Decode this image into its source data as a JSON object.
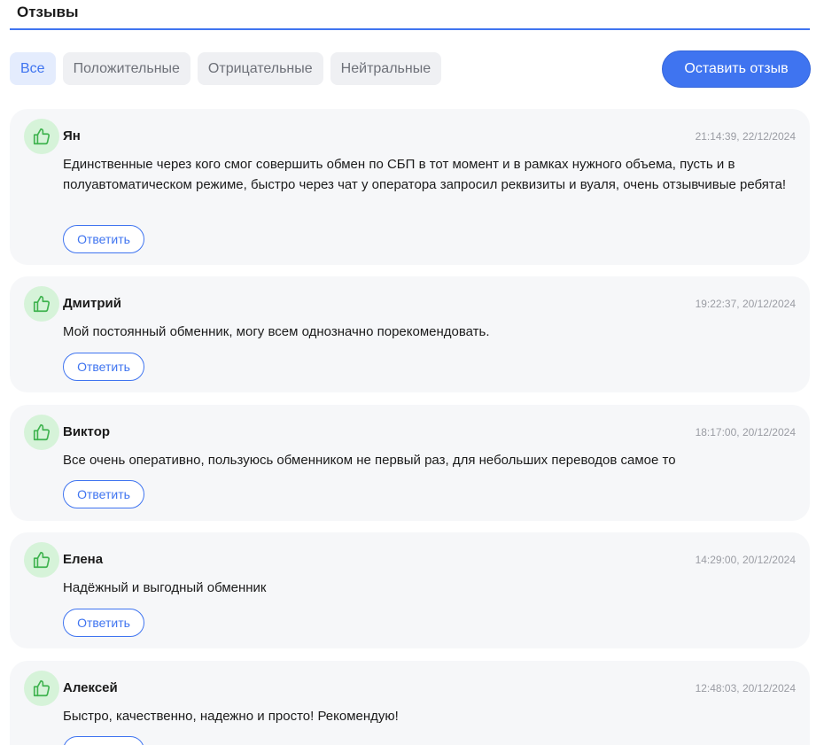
{
  "section": {
    "title": "Отзывы"
  },
  "filters": [
    {
      "label": "Все",
      "active": true
    },
    {
      "label": "Положительные",
      "active": false
    },
    {
      "label": "Отрицательные",
      "active": false
    },
    {
      "label": "Нейтральные",
      "active": false
    }
  ],
  "leave_review_label": "Оставить отзыв",
  "colors": {
    "accent": "#3f74f0",
    "card_bg": "#f6f7f9",
    "positive_icon_bg": "#d6f3d9",
    "positive_icon": "#3fb34f"
  },
  "reviews": [
    {
      "author": "Ян",
      "date": "21:14:39, 22/12/2024",
      "text": "Единственные через кого смог совершить обмен по СБП в тот момент и в рамках нужного объема, пусть и в полуавтоматическом режиме, быстро через чат у оператора запросил реквизиты и вуаля, очень отзывчивые ребята!",
      "sentiment_icon": "thumbs-up-icon",
      "reply_label": "Ответить"
    },
    {
      "author": "Дмитрий",
      "date": "19:22:37, 20/12/2024",
      "text": "Мой постоянный обменник, могу всем однозначно порекомендовать.",
      "sentiment_icon": "thumbs-up-icon",
      "reply_label": "Ответить"
    },
    {
      "author": "Виктор",
      "date": "18:17:00, 20/12/2024",
      "text": "Все очень оперативно, пользуюсь обменником не первый раз, для небольших переводов самое то",
      "sentiment_icon": "thumbs-up-icon",
      "reply_label": "Ответить"
    },
    {
      "author": "Елена",
      "date": "14:29:00, 20/12/2024",
      "text": "Надёжный и выгодный обменник",
      "sentiment_icon": "thumbs-up-icon",
      "reply_label": "Ответить"
    },
    {
      "author": "Алексей",
      "date": "12:48:03, 20/12/2024",
      "text": "Быстро, качественно, надежно и просто! Рекомендую!",
      "sentiment_icon": "thumbs-up-icon",
      "reply_label": "Ответить"
    }
  ]
}
